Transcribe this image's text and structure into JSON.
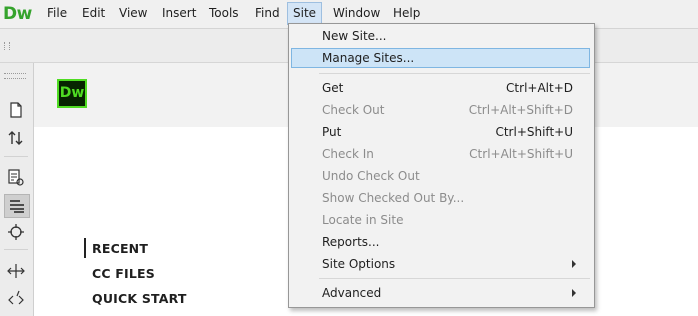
{
  "app": {
    "logo": "Dw"
  },
  "menubar": {
    "items": [
      "File",
      "Edit",
      "View",
      "Insert",
      "Tools",
      "Find",
      "Site",
      "Window",
      "Help"
    ],
    "active": "Site"
  },
  "toolstrip": {
    "icons": [
      "file-icon",
      "sort-arrows-icon",
      "inspect-icon",
      "align-lines-icon",
      "target-icon",
      "move-icon",
      "code-tag-icon"
    ]
  },
  "start_page": {
    "badge": "Dw",
    "links": [
      "RECENT",
      "CC FILES",
      "QUICK START"
    ],
    "selected_link": "RECENT"
  },
  "site_menu": {
    "items": [
      {
        "label": "New Site...",
        "shortcut": "",
        "disabled": false,
        "submenu": false
      },
      {
        "label": "Manage Sites...",
        "shortcut": "",
        "disabled": false,
        "submenu": false,
        "highlighted": true
      },
      {
        "label": "Get",
        "shortcut": "Ctrl+Alt+D",
        "disabled": false,
        "submenu": false
      },
      {
        "label": "Check Out",
        "shortcut": "Ctrl+Alt+Shift+D",
        "disabled": true,
        "submenu": false
      },
      {
        "label": "Put",
        "shortcut": "Ctrl+Shift+U",
        "disabled": false,
        "submenu": false
      },
      {
        "label": "Check In",
        "shortcut": "Ctrl+Alt+Shift+U",
        "disabled": true,
        "submenu": false
      },
      {
        "label": "Undo Check Out",
        "shortcut": "",
        "disabled": true,
        "submenu": false
      },
      {
        "label": "Show Checked Out By...",
        "shortcut": "",
        "disabled": true,
        "submenu": false
      },
      {
        "label": "Locate in Site",
        "shortcut": "",
        "disabled": true,
        "submenu": false
      },
      {
        "label": "Reports...",
        "shortcut": "",
        "disabled": false,
        "submenu": false
      },
      {
        "label": "Site Options",
        "shortcut": "",
        "disabled": false,
        "submenu": true
      },
      {
        "label": "Advanced",
        "shortcut": "",
        "disabled": false,
        "submenu": true
      }
    ]
  },
  "colors": {
    "logo_green": "#35a32c",
    "badge_bg": "#072401",
    "badge_fg": "#4fdc22",
    "highlight": "#cde4f7"
  }
}
